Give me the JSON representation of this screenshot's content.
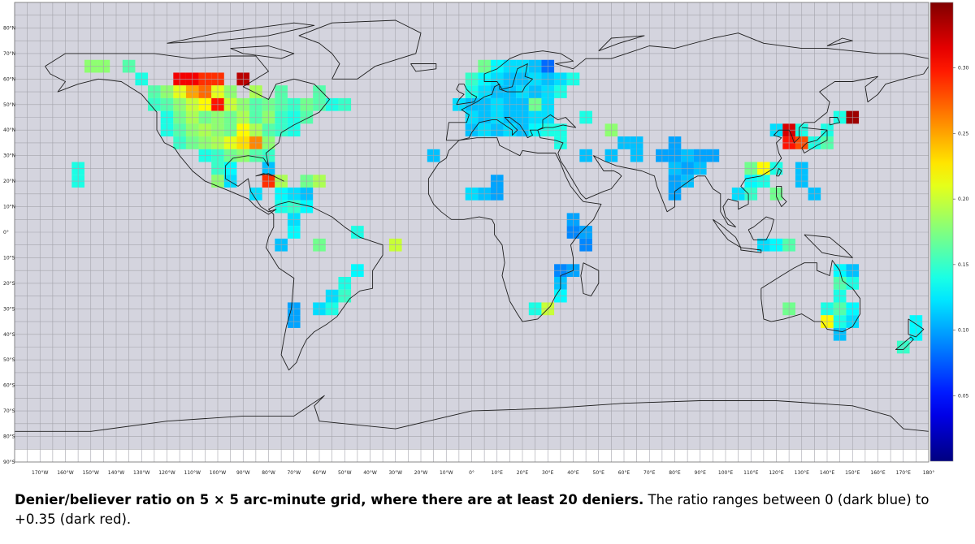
{
  "chart_data": {
    "type": "heatmap",
    "grid_step_degrees": 5,
    "value_range": [
      0,
      0.35
    ],
    "colorscale": "jet (dark blue to dark red)",
    "colors": {
      "ocean": "#d4d4de",
      "grid": "#a3a3ab",
      "coast": "#1e1e1e",
      "low": "#00007f",
      "high": "#7f0000"
    },
    "x_ticks": [
      "170°W",
      "160°W",
      "150°W",
      "140°W",
      "130°W",
      "120°W",
      "110°W",
      "100°W",
      "90°W",
      "80°W",
      "70°W",
      "60°W",
      "50°W",
      "40°W",
      "30°W",
      "20°W",
      "10°W",
      "0°",
      "10°E",
      "20°E",
      "30°E",
      "40°E",
      "50°E",
      "60°E",
      "70°E",
      "80°E",
      "90°E",
      "100°E",
      "110°E",
      "120°E",
      "130°E",
      "140°E",
      "150°E",
      "160°E",
      "170°E",
      "180°"
    ],
    "y_ticks": [
      "80°N",
      "70°N",
      "60°N",
      "50°N",
      "40°N",
      "30°N",
      "20°N",
      "10°N",
      "0°",
      "10°S",
      "20°S",
      "30°S",
      "40°S",
      "50°S",
      "60°S",
      "70°S",
      "80°S",
      "90°S"
    ],
    "colorbar_ticks": [
      "0.30",
      "0.25",
      "0.20",
      "0.15",
      "0.10",
      "0.05"
    ],
    "cells": [
      {
        "lon": -150,
        "lat": 65,
        "v": 0.18
      },
      {
        "lon": -145,
        "lat": 65,
        "v": 0.18
      },
      {
        "lon": -135,
        "lat": 65,
        "v": 0.16
      },
      {
        "lon": -130,
        "lat": 60,
        "v": 0.14
      },
      {
        "lon": -125,
        "lat": 55,
        "v": 0.16
      },
      {
        "lon": -120,
        "lat": 55,
        "v": 0.18
      },
      {
        "lon": -115,
        "lat": 60,
        "v": 0.31
      },
      {
        "lon": -110,
        "lat": 60,
        "v": 0.31
      },
      {
        "lon": -105,
        "lat": 60,
        "v": 0.29
      },
      {
        "lon": -100,
        "lat": 60,
        "v": 0.29
      },
      {
        "lon": -90,
        "lat": 60,
        "v": 0.33
      },
      {
        "lon": -115,
        "lat": 55,
        "v": 0.21
      },
      {
        "lon": -110,
        "lat": 55,
        "v": 0.25
      },
      {
        "lon": -105,
        "lat": 55,
        "v": 0.27
      },
      {
        "lon": -100,
        "lat": 55,
        "v": 0.21
      },
      {
        "lon": -95,
        "lat": 55,
        "v": 0.18
      },
      {
        "lon": -85,
        "lat": 55,
        "v": 0.19
      },
      {
        "lon": -75,
        "lat": 55,
        "v": 0.16
      },
      {
        "lon": -60,
        "lat": 55,
        "v": 0.16
      },
      {
        "lon": -125,
        "lat": 50,
        "v": 0.15
      },
      {
        "lon": -120,
        "lat": 50,
        "v": 0.16
      },
      {
        "lon": -115,
        "lat": 50,
        "v": 0.18
      },
      {
        "lon": -110,
        "lat": 50,
        "v": 0.2
      },
      {
        "lon": -105,
        "lat": 50,
        "v": 0.22
      },
      {
        "lon": -100,
        "lat": 50,
        "v": 0.3
      },
      {
        "lon": -95,
        "lat": 50,
        "v": 0.2
      },
      {
        "lon": -90,
        "lat": 50,
        "v": 0.18
      },
      {
        "lon": -85,
        "lat": 50,
        "v": 0.16
      },
      {
        "lon": -80,
        "lat": 50,
        "v": 0.17
      },
      {
        "lon": -75,
        "lat": 50,
        "v": 0.16
      },
      {
        "lon": -70,
        "lat": 50,
        "v": 0.15
      },
      {
        "lon": -65,
        "lat": 50,
        "v": 0.17
      },
      {
        "lon": -60,
        "lat": 50,
        "v": 0.16
      },
      {
        "lon": -55,
        "lat": 50,
        "v": 0.14
      },
      {
        "lon": -50,
        "lat": 50,
        "v": 0.15
      },
      {
        "lon": -120,
        "lat": 45,
        "v": 0.14
      },
      {
        "lon": -115,
        "lat": 45,
        "v": 0.17
      },
      {
        "lon": -110,
        "lat": 45,
        "v": 0.19
      },
      {
        "lon": -105,
        "lat": 45,
        "v": 0.17
      },
      {
        "lon": -100,
        "lat": 45,
        "v": 0.18
      },
      {
        "lon": -95,
        "lat": 45,
        "v": 0.17
      },
      {
        "lon": -90,
        "lat": 45,
        "v": 0.19
      },
      {
        "lon": -85,
        "lat": 45,
        "v": 0.16
      },
      {
        "lon": -80,
        "lat": 45,
        "v": 0.18
      },
      {
        "lon": -75,
        "lat": 45,
        "v": 0.15
      },
      {
        "lon": -70,
        "lat": 45,
        "v": 0.14
      },
      {
        "lon": -65,
        "lat": 45,
        "v": 0.16
      },
      {
        "lon": -120,
        "lat": 40,
        "v": 0.14
      },
      {
        "lon": -115,
        "lat": 40,
        "v": 0.16
      },
      {
        "lon": -110,
        "lat": 40,
        "v": 0.18
      },
      {
        "lon": -105,
        "lat": 40,
        "v": 0.19
      },
      {
        "lon": -100,
        "lat": 40,
        "v": 0.18
      },
      {
        "lon": -95,
        "lat": 40,
        "v": 0.17
      },
      {
        "lon": -90,
        "lat": 40,
        "v": 0.22
      },
      {
        "lon": -85,
        "lat": 40,
        "v": 0.19
      },
      {
        "lon": -80,
        "lat": 40,
        "v": 0.16
      },
      {
        "lon": -75,
        "lat": 40,
        "v": 0.15
      },
      {
        "lon": -70,
        "lat": 40,
        "v": 0.14
      },
      {
        "lon": -115,
        "lat": 35,
        "v": 0.15
      },
      {
        "lon": -110,
        "lat": 35,
        "v": 0.17
      },
      {
        "lon": -105,
        "lat": 35,
        "v": 0.18
      },
      {
        "lon": -100,
        "lat": 35,
        "v": 0.19
      },
      {
        "lon": -95,
        "lat": 35,
        "v": 0.21
      },
      {
        "lon": -90,
        "lat": 35,
        "v": 0.23
      },
      {
        "lon": -85,
        "lat": 35,
        "v": 0.26
      },
      {
        "lon": -80,
        "lat": 35,
        "v": 0.18
      },
      {
        "lon": -105,
        "lat": 30,
        "v": 0.14
      },
      {
        "lon": -100,
        "lat": 30,
        "v": 0.15
      },
      {
        "lon": -95,
        "lat": 30,
        "v": 0.17
      },
      {
        "lon": -90,
        "lat": 30,
        "v": 0.18
      },
      {
        "lon": -85,
        "lat": 30,
        "v": 0.16
      },
      {
        "lon": -80,
        "lat": 30,
        "v": 0.15
      },
      {
        "lon": -155,
        "lat": 25,
        "v": 0.14
      },
      {
        "lon": -155,
        "lat": 20,
        "v": 0.14
      },
      {
        "lon": -100,
        "lat": 25,
        "v": 0.15
      },
      {
        "lon": -95,
        "lat": 25,
        "v": 0.13
      },
      {
        "lon": -80,
        "lat": 25,
        "v": 0.11
      },
      {
        "lon": -100,
        "lat": 20,
        "v": 0.18
      },
      {
        "lon": -95,
        "lat": 20,
        "v": 0.12
      },
      {
        "lon": -80,
        "lat": 20,
        "v": 0.29
      },
      {
        "lon": -75,
        "lat": 20,
        "v": 0.19
      },
      {
        "lon": -65,
        "lat": 20,
        "v": 0.17
      },
      {
        "lon": -60,
        "lat": 20,
        "v": 0.19
      },
      {
        "lon": -85,
        "lat": 15,
        "v": 0.12
      },
      {
        "lon": -75,
        "lat": 15,
        "v": 0.13
      },
      {
        "lon": -70,
        "lat": 15,
        "v": 0.12
      },
      {
        "lon": -65,
        "lat": 15,
        "v": 0.11
      },
      {
        "lon": -75,
        "lat": 10,
        "v": 0.14
      },
      {
        "lon": -70,
        "lat": 10,
        "v": 0.15
      },
      {
        "lon": -65,
        "lat": 10,
        "v": 0.13
      },
      {
        "lon": -70,
        "lat": 5,
        "v": 0.12
      },
      {
        "lon": -45,
        "lat": 0,
        "v": 0.14
      },
      {
        "lon": -70,
        "lat": 0,
        "v": 0.13
      },
      {
        "lon": -30,
        "lat": -5,
        "v": 0.2
      },
      {
        "lon": -75,
        "lat": -5,
        "v": 0.11
      },
      {
        "lon": -60,
        "lat": -5,
        "v": 0.17
      },
      {
        "lon": -45,
        "lat": -15,
        "v": 0.13
      },
      {
        "lon": -50,
        "lat": -20,
        "v": 0.14
      },
      {
        "lon": -55,
        "lat": -25,
        "v": 0.12
      },
      {
        "lon": -50,
        "lat": -25,
        "v": 0.15
      },
      {
        "lon": -70,
        "lat": -30,
        "v": 0.1
      },
      {
        "lon": -60,
        "lat": -30,
        "v": 0.12
      },
      {
        "lon": -55,
        "lat": -30,
        "v": 0.14
      },
      {
        "lon": -70,
        "lat": -35,
        "v": 0.1
      },
      {
        "lon": -15,
        "lat": 30,
        "v": 0.11
      },
      {
        "lon": 0,
        "lat": 15,
        "v": 0.12
      },
      {
        "lon": 5,
        "lat": 15,
        "v": 0.11
      },
      {
        "lon": 10,
        "lat": 15,
        "v": 0.1
      },
      {
        "lon": 10,
        "lat": 20,
        "v": 0.1
      },
      {
        "lon": 5,
        "lat": 65,
        "v": 0.17
      },
      {
        "lon": 10,
        "lat": 65,
        "v": 0.13
      },
      {
        "lon": 15,
        "lat": 65,
        "v": 0.12
      },
      {
        "lon": 20,
        "lat": 65,
        "v": 0.12
      },
      {
        "lon": 25,
        "lat": 65,
        "v": 0.11
      },
      {
        "lon": 30,
        "lat": 65,
        "v": 0.08
      },
      {
        "lon": 0,
        "lat": 60,
        "v": 0.15
      },
      {
        "lon": 5,
        "lat": 60,
        "v": 0.13
      },
      {
        "lon": 10,
        "lat": 60,
        "v": 0.12
      },
      {
        "lon": 15,
        "lat": 60,
        "v": 0.11
      },
      {
        "lon": 20,
        "lat": 60,
        "v": 0.11
      },
      {
        "lon": 25,
        "lat": 60,
        "v": 0.12
      },
      {
        "lon": 30,
        "lat": 60,
        "v": 0.11
      },
      {
        "lon": 35,
        "lat": 60,
        "v": 0.12
      },
      {
        "lon": 40,
        "lat": 60,
        "v": 0.14
      },
      {
        "lon": 0,
        "lat": 55,
        "v": 0.14
      },
      {
        "lon": 5,
        "lat": 55,
        "v": 0.12
      },
      {
        "lon": 10,
        "lat": 55,
        "v": 0.11
      },
      {
        "lon": 15,
        "lat": 55,
        "v": 0.11
      },
      {
        "lon": 20,
        "lat": 55,
        "v": 0.12
      },
      {
        "lon": 25,
        "lat": 55,
        "v": 0.11
      },
      {
        "lon": 30,
        "lat": 55,
        "v": 0.12
      },
      {
        "lon": 35,
        "lat": 55,
        "v": 0.14
      },
      {
        "lon": -5,
        "lat": 50,
        "v": 0.12
      },
      {
        "lon": 0,
        "lat": 50,
        "v": 0.11
      },
      {
        "lon": 5,
        "lat": 50,
        "v": 0.11
      },
      {
        "lon": 10,
        "lat": 50,
        "v": 0.12
      },
      {
        "lon": 15,
        "lat": 50,
        "v": 0.11
      },
      {
        "lon": 20,
        "lat": 50,
        "v": 0.11
      },
      {
        "lon": 25,
        "lat": 50,
        "v": 0.17
      },
      {
        "lon": 30,
        "lat": 50,
        "v": 0.12
      },
      {
        "lon": 0,
        "lat": 45,
        "v": 0.12
      },
      {
        "lon": 5,
        "lat": 45,
        "v": 0.11
      },
      {
        "lon": 10,
        "lat": 45,
        "v": 0.12
      },
      {
        "lon": 15,
        "lat": 45,
        "v": 0.11
      },
      {
        "lon": 20,
        "lat": 45,
        "v": 0.11
      },
      {
        "lon": 25,
        "lat": 45,
        "v": 0.12
      },
      {
        "lon": 30,
        "lat": 45,
        "v": 0.12
      },
      {
        "lon": 45,
        "lat": 45,
        "v": 0.14
      },
      {
        "lon": 0,
        "lat": 40,
        "v": 0.11
      },
      {
        "lon": 5,
        "lat": 40,
        "v": 0.12
      },
      {
        "lon": 10,
        "lat": 40,
        "v": 0.11
      },
      {
        "lon": 15,
        "lat": 40,
        "v": 0.12
      },
      {
        "lon": 20,
        "lat": 40,
        "v": 0.11
      },
      {
        "lon": 25,
        "lat": 40,
        "v": 0.13
      },
      {
        "lon": 30,
        "lat": 40,
        "v": 0.14
      },
      {
        "lon": 35,
        "lat": 40,
        "v": 0.14
      },
      {
        "lon": 55,
        "lat": 40,
        "v": 0.18
      },
      {
        "lon": 35,
        "lat": 35,
        "v": 0.14
      },
      {
        "lon": 45,
        "lat": 30,
        "v": 0.11
      },
      {
        "lon": 55,
        "lat": 30,
        "v": 0.11
      },
      {
        "lon": 60,
        "lat": 35,
        "v": 0.11
      },
      {
        "lon": 65,
        "lat": 35,
        "v": 0.11
      },
      {
        "lon": 65,
        "lat": 30,
        "v": 0.11
      },
      {
        "lon": 40,
        "lat": 5,
        "v": 0.1
      },
      {
        "lon": 40,
        "lat": 0,
        "v": 0.09
      },
      {
        "lon": 45,
        "lat": 0,
        "v": 0.1
      },
      {
        "lon": 45,
        "lat": -5,
        "v": 0.09
      },
      {
        "lon": 35,
        "lat": -15,
        "v": 0.09
      },
      {
        "lon": 40,
        "lat": -15,
        "v": 0.1
      },
      {
        "lon": 35,
        "lat": -20,
        "v": 0.11
      },
      {
        "lon": 35,
        "lat": -25,
        "v": 0.13
      },
      {
        "lon": 25,
        "lat": -30,
        "v": 0.14
      },
      {
        "lon": 30,
        "lat": -30,
        "v": 0.2
      },
      {
        "lon": 80,
        "lat": 35,
        "v": 0.1
      },
      {
        "lon": 75,
        "lat": 30,
        "v": 0.1
      },
      {
        "lon": 80,
        "lat": 30,
        "v": 0.1
      },
      {
        "lon": 85,
        "lat": 30,
        "v": 0.11
      },
      {
        "lon": 90,
        "lat": 30,
        "v": 0.1
      },
      {
        "lon": 95,
        "lat": 30,
        "v": 0.1
      },
      {
        "lon": 80,
        "lat": 25,
        "v": 0.11
      },
      {
        "lon": 85,
        "lat": 25,
        "v": 0.1
      },
      {
        "lon": 90,
        "lat": 25,
        "v": 0.11
      },
      {
        "lon": 80,
        "lat": 20,
        "v": 0.1
      },
      {
        "lon": 85,
        "lat": 20,
        "v": 0.11
      },
      {
        "lon": 80,
        "lat": 15,
        "v": 0.1
      },
      {
        "lon": 110,
        "lat": 25,
        "v": 0.17
      },
      {
        "lon": 115,
        "lat": 25,
        "v": 0.22
      },
      {
        "lon": 120,
        "lat": 25,
        "v": 0.14
      },
      {
        "lon": 110,
        "lat": 20,
        "v": 0.13
      },
      {
        "lon": 115,
        "lat": 20,
        "v": 0.14
      },
      {
        "lon": 110,
        "lat": 15,
        "v": 0.15
      },
      {
        "lon": 105,
        "lat": 15,
        "v": 0.12
      },
      {
        "lon": 120,
        "lat": 15,
        "v": 0.17
      },
      {
        "lon": 130,
        "lat": 25,
        "v": 0.11
      },
      {
        "lon": 130,
        "lat": 20,
        "v": 0.11
      },
      {
        "lon": 135,
        "lat": 15,
        "v": 0.11
      },
      {
        "lon": 115,
        "lat": -5,
        "v": 0.12
      },
      {
        "lon": 120,
        "lat": -5,
        "v": 0.13
      },
      {
        "lon": 125,
        "lat": -5,
        "v": 0.16
      },
      {
        "lon": 120,
        "lat": 40,
        "v": 0.12
      },
      {
        "lon": 125,
        "lat": 40,
        "v": 0.32
      },
      {
        "lon": 130,
        "lat": 40,
        "v": 0.14
      },
      {
        "lon": 125,
        "lat": 35,
        "v": 0.3
      },
      {
        "lon": 130,
        "lat": 35,
        "v": 0.28
      },
      {
        "lon": 135,
        "lat": 35,
        "v": 0.14
      },
      {
        "lon": 140,
        "lat": 35,
        "v": 0.16
      },
      {
        "lon": 140,
        "lat": 40,
        "v": 0.14
      },
      {
        "lon": 145,
        "lat": 45,
        "v": 0.14
      },
      {
        "lon": 150,
        "lat": 45,
        "v": 0.34
      },
      {
        "lon": 145,
        "lat": -15,
        "v": 0.13
      },
      {
        "lon": 150,
        "lat": -15,
        "v": 0.11
      },
      {
        "lon": 150,
        "lat": -20,
        "v": 0.14
      },
      {
        "lon": 145,
        "lat": -20,
        "v": 0.16
      },
      {
        "lon": 145,
        "lat": -25,
        "v": 0.14
      },
      {
        "lon": 140,
        "lat": -30,
        "v": 0.14
      },
      {
        "lon": 145,
        "lat": -30,
        "v": 0.16
      },
      {
        "lon": 150,
        "lat": -30,
        "v": 0.13
      },
      {
        "lon": 140,
        "lat": -35,
        "v": 0.22
      },
      {
        "lon": 145,
        "lat": -35,
        "v": 0.14
      },
      {
        "lon": 150,
        "lat": -35,
        "v": 0.12
      },
      {
        "lon": 145,
        "lat": -40,
        "v": 0.11
      },
      {
        "lon": 125,
        "lat": -30,
        "v": 0.17
      },
      {
        "lon": 175,
        "lat": -35,
        "v": 0.13
      },
      {
        "lon": 175,
        "lat": -40,
        "v": 0.13
      },
      {
        "lon": 170,
        "lat": -45,
        "v": 0.15
      }
    ]
  },
  "caption": {
    "bold": "Denier/believer ratio on 5 × 5 arc-minute grid, where there are at least 20 deniers.",
    "rest": " The ratio ranges between 0 (dark blue) to +0.35 (dark red)."
  }
}
